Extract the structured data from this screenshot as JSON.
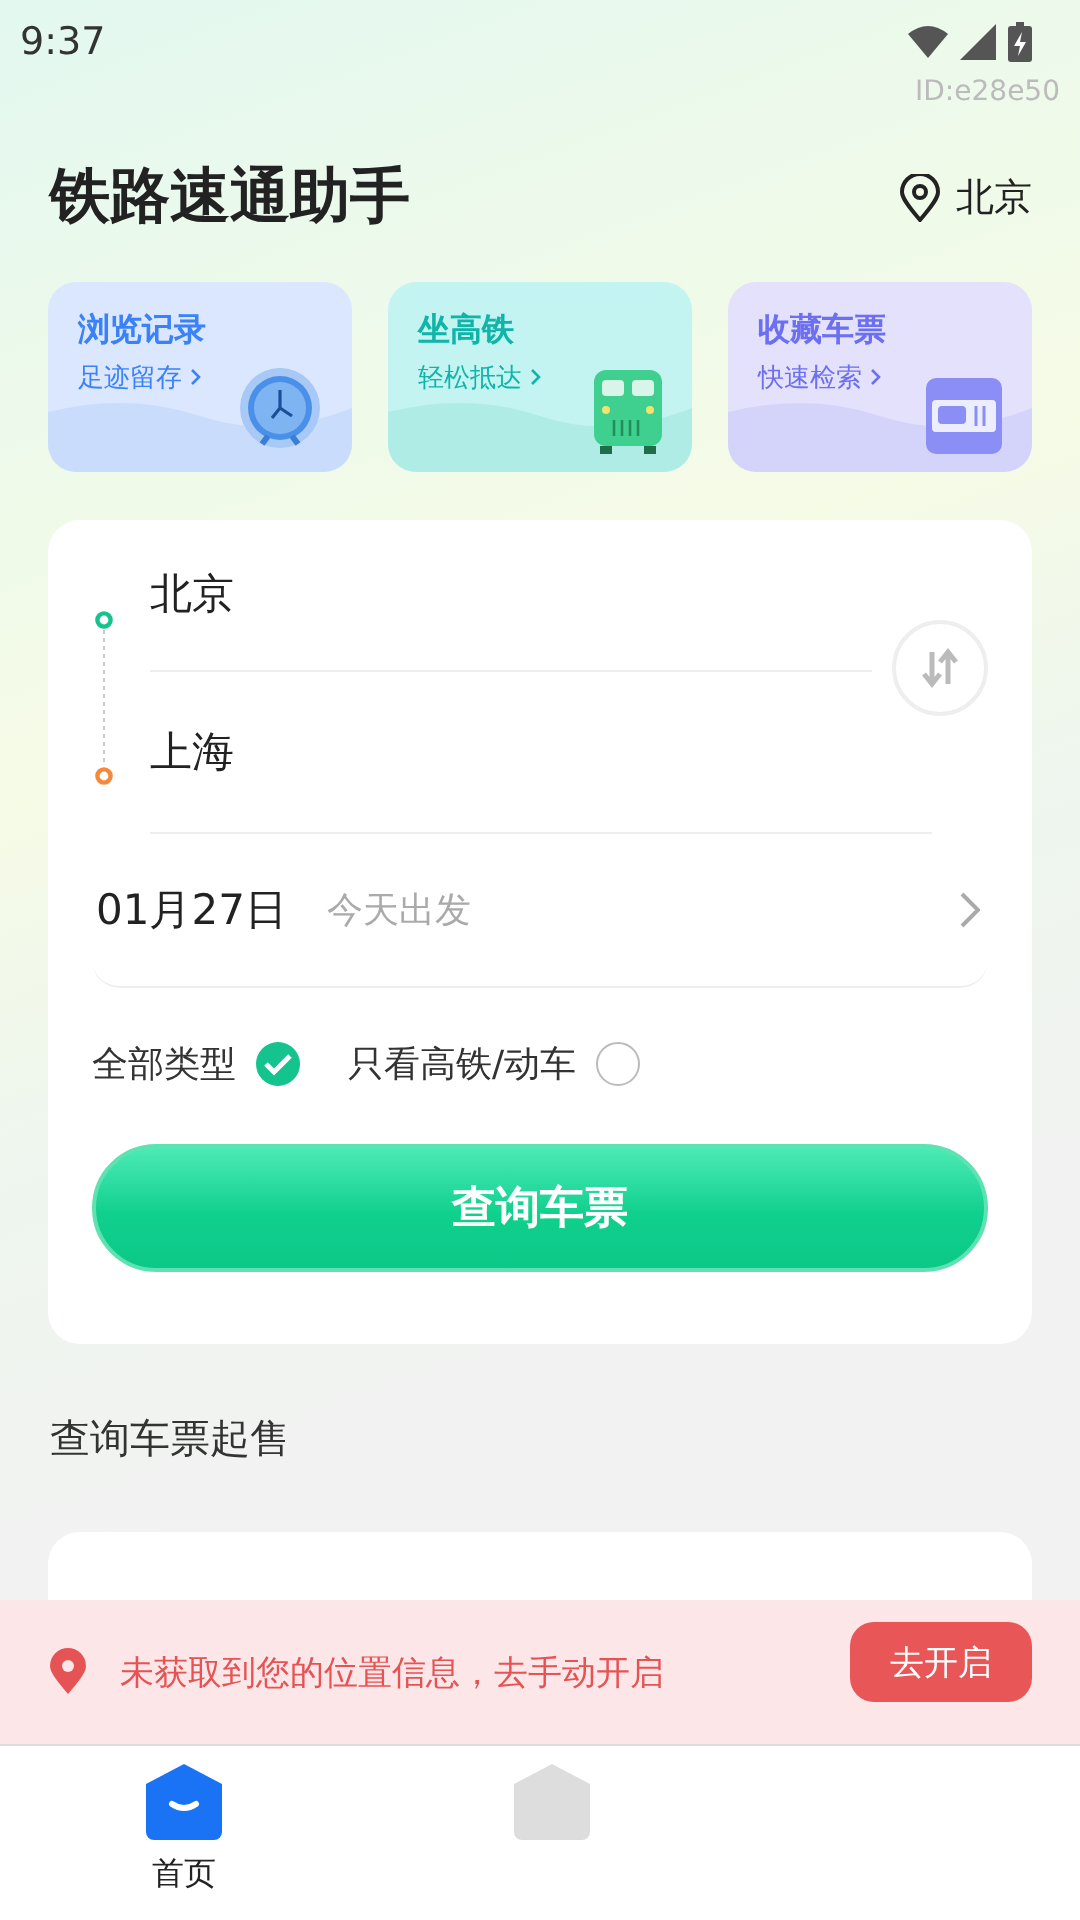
{
  "status_bar": {
    "time": "9:37"
  },
  "user_id": "ID:e28e50",
  "header": {
    "title": "铁路速通助手",
    "city": "北京"
  },
  "shortcuts": [
    {
      "kind": "clock",
      "title": "浏览记录",
      "subtitle": "足迹留存",
      "color": "#3b82f6"
    },
    {
      "kind": "train",
      "title": "坐高铁",
      "subtitle": "轻松抵达",
      "color": "#0fb5a8"
    },
    {
      "kind": "ticket",
      "title": "收藏车票",
      "subtitle": "快速检索",
      "color": "#6b6ff0"
    }
  ],
  "search": {
    "from": "北京",
    "to": "上海",
    "date": "01月27日",
    "date_hint": "今天出发",
    "filters": [
      {
        "label": "全部类型",
        "selected": true
      },
      {
        "label": "只看高铁/动车",
        "selected": false
      }
    ],
    "button": "查询车票"
  },
  "section_title": "查询车票起售",
  "location_banner": {
    "message": "未获取到您的位置信息，去手动开启",
    "button": "去开启"
  },
  "bottom_nav": [
    {
      "label": "首页",
      "selected": true
    },
    {
      "selected": false
    }
  ]
}
